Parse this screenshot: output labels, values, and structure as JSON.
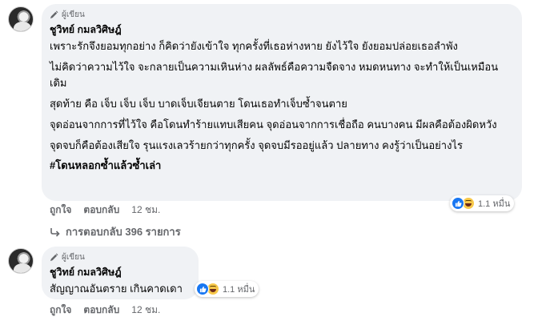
{
  "comment1": {
    "badge": "ผู้เขียน",
    "author": "ชูวิทย์ กมลวิศิษฎ์",
    "paragraphs": [
      "เพราะรักจึงยอมทุกอย่าง ก็คิดว่ายังเข้าใจ ทุกครั้งที่เธอห่างหาย ยังไว้ใจ ยังยอมปล่อยเธอลำพัง",
      "ไม่คิดว่าความไว้ใจ จะกลายเป็นความเหินห่าง ผลลัพธ์คือความจืดจาง หมดหนทาง จะทำให้เป็นเหมือนเดิม",
      "สุดท้าย คือ เจ็บ เจ็บ เจ็บ บาดเจ็บเจียนตาย โดนเธอทำเจ็บซ้ำจนตาย",
      "จุดอ่อนจากการที่ไว้ใจ คือโดนทำร้ายแทบเสียคน จุดอ่อนจากการเชื่อถือ คนบางคน มีผลคือต้องผิดหวัง",
      "จุดจบก็คือต้องเสียใจ รุนแรงเลวร้ายกว่าทุกครั้ง จุดจบมีรออยู่แล้ว ปลายทาง คงรู้ว่าเป็นอย่างไร"
    ],
    "hashtag": "#โดนหลอกซ้ำแล้วซ้ำเล่า",
    "reaction_count": "1.1 หมื่น",
    "like_label": "ถูกใจ",
    "reply_label": "ตอบกลับ",
    "time": "12 ชม."
  },
  "view_replies": "การตอบกลับ 396 รายการ",
  "comment2": {
    "badge": "ผู้เขียน",
    "author": "ชูวิทย์ กมลวิศิษฎ์",
    "text": "สัญญาณอันตราย เกินคาดเดา",
    "reaction_count": "1.1 หมื่น",
    "like_label": "ถูกใจ",
    "reply_label": "ตอบกลับ",
    "time": "12 ชม."
  },
  "icons": {
    "author_badge": "pen-icon",
    "reactions": [
      "like-icon",
      "haha-icon"
    ],
    "view_replies": "reply-arrow-icon"
  },
  "colors": {
    "bubble_bg": "#f0f2f5",
    "secondary_text": "#65676b",
    "like_blue": "#1877f2"
  }
}
